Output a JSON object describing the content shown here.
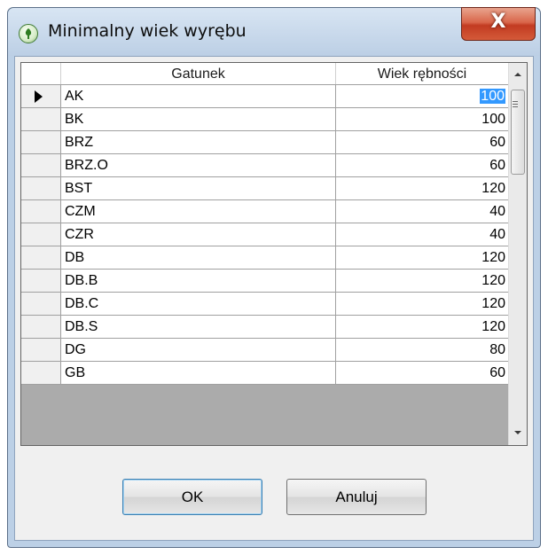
{
  "window": {
    "title": "Minimalny wiek wyrębu",
    "close_label": "X"
  },
  "grid": {
    "columns": [
      "Gatunek",
      "Wiek rębności"
    ],
    "rows": [
      {
        "name": "AK",
        "value": "100",
        "current": true
      },
      {
        "name": "BK",
        "value": "100"
      },
      {
        "name": "BRZ",
        "value": "60"
      },
      {
        "name": "BRZ.O",
        "value": "60"
      },
      {
        "name": "BST",
        "value": "120"
      },
      {
        "name": "CZM",
        "value": "40"
      },
      {
        "name": "CZR",
        "value": "40"
      },
      {
        "name": "DB",
        "value": "120"
      },
      {
        "name": "DB.B",
        "value": "120"
      },
      {
        "name": "DB.C",
        "value": "120"
      },
      {
        "name": "DB.S",
        "value": "120"
      },
      {
        "name": "DG",
        "value": "80"
      },
      {
        "name": "GB",
        "value": "60"
      }
    ]
  },
  "buttons": {
    "ok": "OK",
    "cancel": "Anuluj"
  },
  "colors": {
    "selection": "#3399ff",
    "titlebar": "#bcd0e6",
    "close": "#c94a2f"
  }
}
